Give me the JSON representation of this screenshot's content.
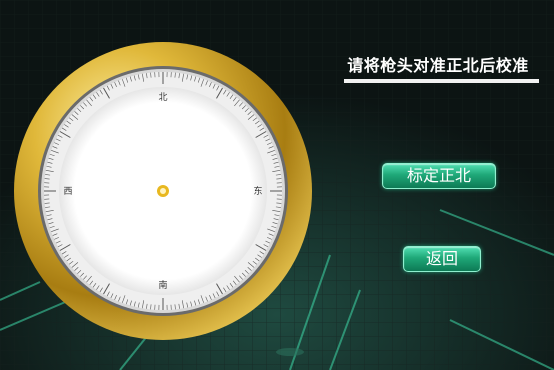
{
  "instruction": "请将枪头对准正北后校准",
  "buttons": {
    "calibrate": "标定正北",
    "back": "返回"
  },
  "compass": {
    "north": "北",
    "south": "南",
    "east": "东",
    "west": "西"
  },
  "colors": {
    "accent": "#1fa878",
    "ring": "#c9a227",
    "background": "#0c1413"
  }
}
